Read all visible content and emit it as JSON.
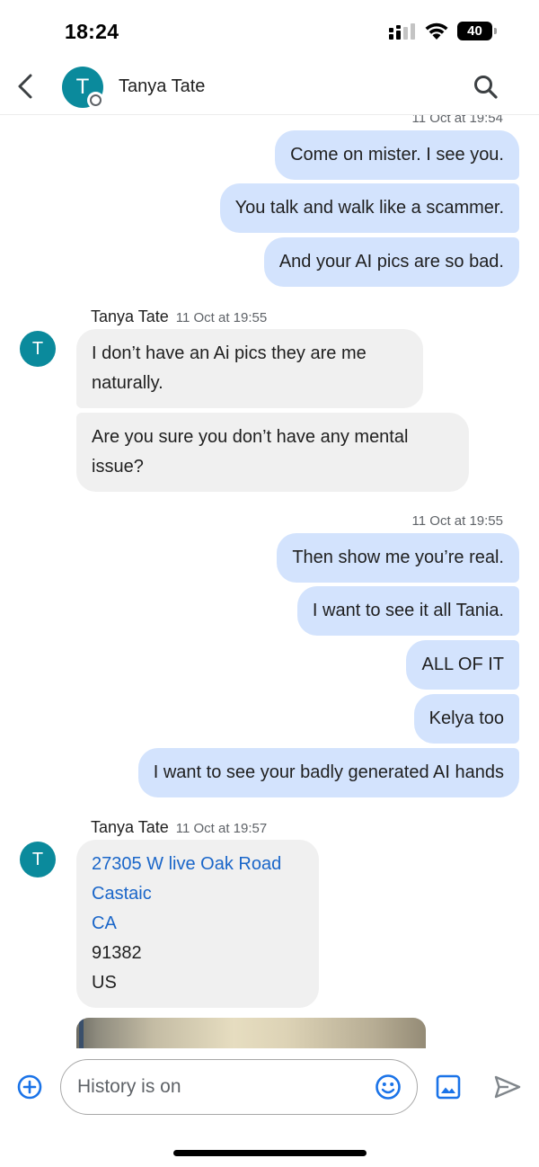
{
  "status_bar": {
    "time": "18:24",
    "battery": "40"
  },
  "header": {
    "contact_name": "Tanya Tate",
    "avatar_initial": "T"
  },
  "conversation": {
    "ts1": "11 Oct at 19:54",
    "group1": [
      "Come on mister. I see you.",
      "You talk and walk like a scammer.",
      "And your AI pics are so bad."
    ],
    "incoming1": {
      "sender": "Tanya Tate",
      "time": "11 Oct at 19:55",
      "avatar_initial": "T",
      "messages": [
        [
          "I don’t have an Ai pics they are me",
          "naturally."
        ],
        [
          "Are you sure you don’t have any mental",
          "issue?"
        ]
      ]
    },
    "ts2": "11 Oct at 19:55",
    "group2": [
      "Then show me you’re real.",
      "I want to see it all Tania.",
      "ALL OF IT",
      "Kelya too",
      "I want to see your badly generated AI hands"
    ],
    "incoming2": {
      "sender": "Tanya Tate",
      "time": "11 Oct at 19:57",
      "avatar_initial": "T",
      "address": [
        "27305 W live Oak Road",
        "Castaic",
        "CA",
        "91382",
        "US"
      ]
    }
  },
  "composer": {
    "placeholder": "History is on"
  },
  "icons": {
    "back": "back-arrow-icon",
    "search": "search-icon",
    "add": "add-circle-icon",
    "emoji": "emoji-icon",
    "gallery": "gallery-icon",
    "send": "send-icon"
  },
  "colors": {
    "outgoing_bubble": "#d3e3fd",
    "incoming_bubble": "#f0f0f0",
    "avatar": "#0b8a9c",
    "link": "#1a66c9",
    "accent": "#1a73e8"
  }
}
